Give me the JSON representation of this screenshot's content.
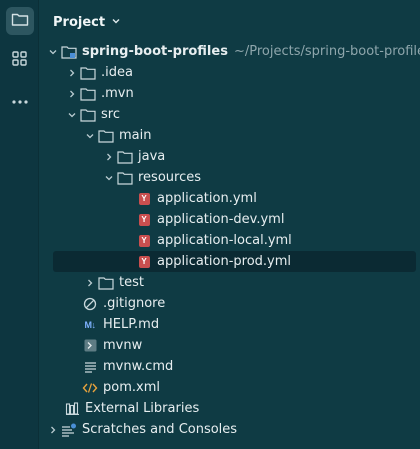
{
  "panel": {
    "title": "Project"
  },
  "activity_bar": {
    "items": [
      "folder-icon",
      "structure-icon",
      "more-icon"
    ]
  },
  "tree": {
    "root": {
      "label": "spring-boot-profiles",
      "path": "~/Projects/spring-boot-profiles"
    },
    "idea": ".idea",
    "mvn": ".mvn",
    "src": "src",
    "main": "main",
    "java": "java",
    "resources": "resources",
    "files_yml": [
      "application.yml",
      "application-dev.yml",
      "application-local.yml",
      "application-prod.yml"
    ],
    "test": "test",
    "gitignore": ".gitignore",
    "help": "HELP.md",
    "mvnw": "mvnw",
    "mvnw_cmd": "mvnw.cmd",
    "pom": "pom.xml",
    "external_libraries": "External Libraries",
    "scratches": "Scratches and Consoles",
    "yml_badge": "Y",
    "md_badge": "M↓"
  }
}
